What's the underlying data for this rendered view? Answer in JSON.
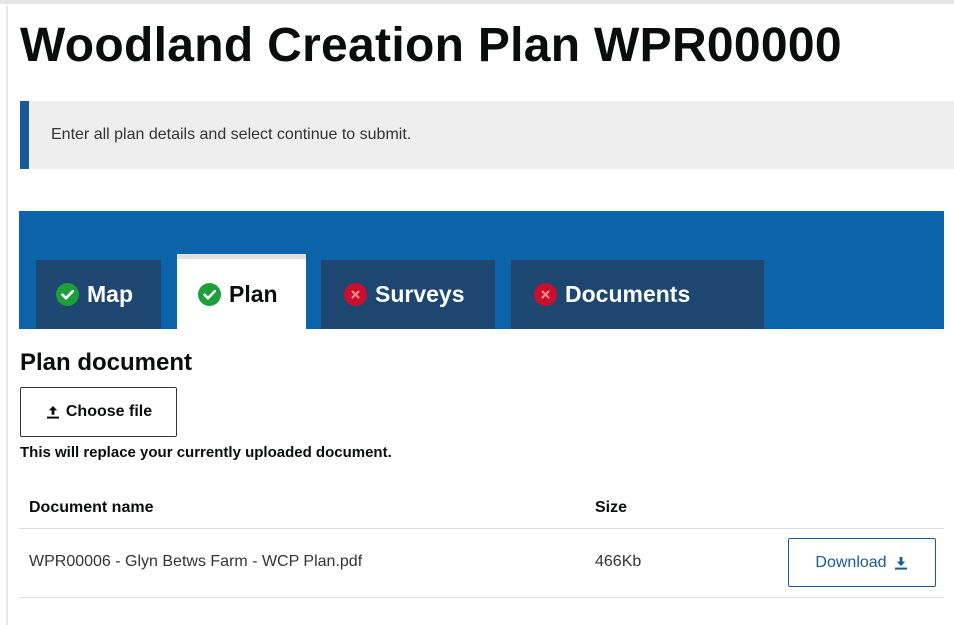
{
  "page": {
    "title": "Woodland Creation Plan WPR00000"
  },
  "notice": {
    "text": "Enter all plan details and select continue to submit."
  },
  "tabs": [
    {
      "label": "Map",
      "status": "complete",
      "icon": "check-circle-icon",
      "active": false
    },
    {
      "label": "Plan",
      "status": "complete",
      "icon": "check-circle-icon",
      "active": true
    },
    {
      "label": "Surveys",
      "status": "incomplete",
      "icon": "cross-circle-icon",
      "active": false
    },
    {
      "label": "Documents",
      "status": "incomplete",
      "icon": "cross-circle-icon",
      "active": false
    }
  ],
  "plan_document": {
    "heading": "Plan document",
    "choose_file_label": "Choose file",
    "choose_file_icon": "upload-icon",
    "hint": "This will replace your currently uploaded document.",
    "table": {
      "columns": [
        "Document name",
        "Size"
      ],
      "rows": [
        {
          "name": "WPR00006 - Glyn Betws Farm - WCP Plan.pdf",
          "size": "466Kb",
          "action_label": "Download",
          "action_icon": "download-icon"
        }
      ]
    }
  },
  "colors": {
    "tab_band": "#0b63aa",
    "tab_inactive": "#1d4771",
    "inset_border": "#1a5a96",
    "inset_background": "#eeeeee",
    "status_complete": "#1f9e3c",
    "status_incomplete": "#c8102e",
    "link": "#1a5a96"
  }
}
